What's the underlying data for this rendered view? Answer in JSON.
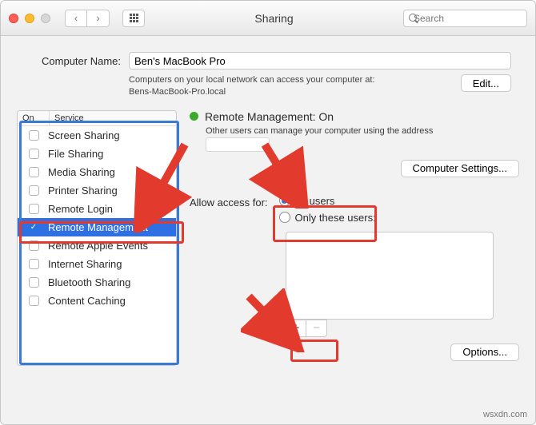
{
  "window": {
    "title": "Sharing"
  },
  "search": {
    "placeholder": "Search"
  },
  "computer_name": {
    "label": "Computer Name:",
    "value": "Ben's MacBook Pro",
    "desc1": "Computers on your local network can access your computer at:",
    "desc2": "Bens-MacBook-Pro.local",
    "edit_label": "Edit..."
  },
  "services": {
    "col_on": "On",
    "col_service": "Service",
    "items": [
      {
        "label": "Screen Sharing",
        "checked": false
      },
      {
        "label": "File Sharing",
        "checked": false
      },
      {
        "label": "Media Sharing",
        "checked": false
      },
      {
        "label": "Printer Sharing",
        "checked": false
      },
      {
        "label": "Remote Login",
        "checked": false
      },
      {
        "label": "Remote Management",
        "checked": true
      },
      {
        "label": "Remote Apple Events",
        "checked": false
      },
      {
        "label": "Internet Sharing",
        "checked": false
      },
      {
        "label": "Bluetooth Sharing",
        "checked": false
      },
      {
        "label": "Content Caching",
        "checked": false
      }
    ]
  },
  "right": {
    "status": "Remote Management: On",
    "desc": "Other users can manage your computer using the address",
    "computer_settings": "Computer Settings...",
    "allow_label": "Allow access for:",
    "radio_all": "All users",
    "radio_only": "Only these users:",
    "options": "Options..."
  },
  "watermark": "wsxdn.com"
}
